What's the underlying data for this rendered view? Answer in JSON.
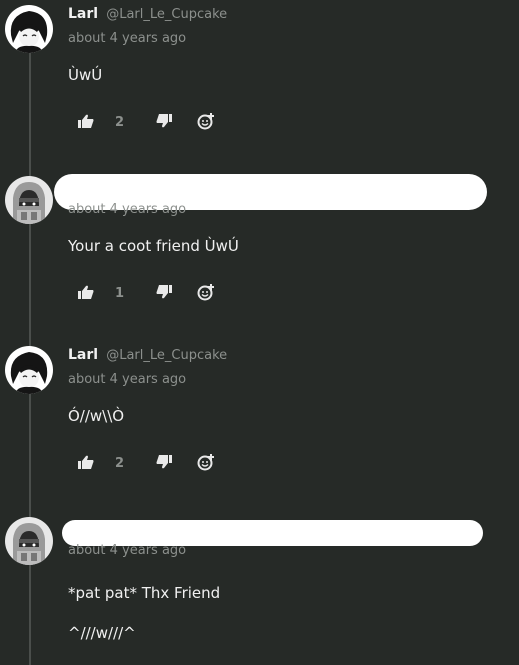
{
  "comments": [
    {
      "author": "Larl",
      "handle": "@Larl_Le_Cupcake",
      "time": "about 4 years ago",
      "paragraphs": [
        "ÙwÚ"
      ],
      "likes": "2",
      "avatar": "larl-avatar",
      "redacted": false
    },
    {
      "author": "",
      "handle": "",
      "time": "about 4 years ago",
      "paragraphs": [
        "Your a coot friend ÙwÚ"
      ],
      "likes": "1",
      "avatar": "hooded-avatar",
      "redacted": true
    },
    {
      "author": "Larl",
      "handle": "@Larl_Le_Cupcake",
      "time": "about 4 years ago",
      "paragraphs": [
        "Ó//w\\\\Ò"
      ],
      "likes": "2",
      "avatar": "larl-avatar",
      "redacted": false
    },
    {
      "author": "",
      "handle": "",
      "time": "about 4 years ago",
      "paragraphs": [
        "*pat pat* Thx Friend",
        "^///w///^"
      ],
      "likes": "",
      "avatar": "hooded-avatar",
      "redacted": true
    }
  ],
  "icons": {
    "like": "thumbs-up-icon",
    "dislike": "thumbs-down-icon",
    "react": "add-reaction-icon"
  },
  "colors": {
    "background": "#262a27",
    "muted": "#8c908d",
    "text": "#f0f0f0",
    "redaction": "#ffffff"
  }
}
